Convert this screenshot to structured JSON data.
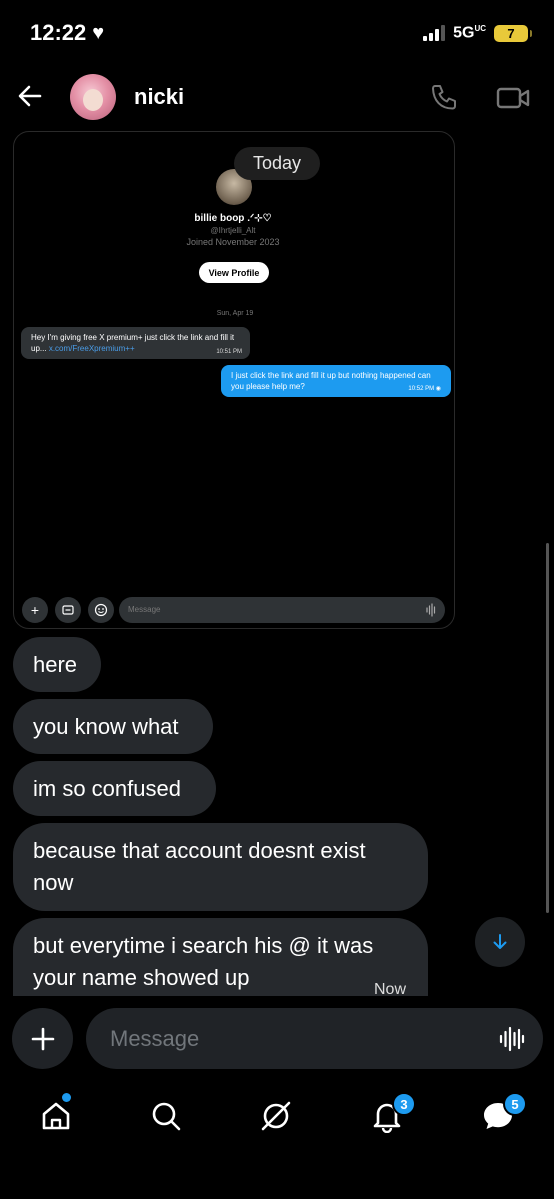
{
  "status_bar": {
    "time": "12:22",
    "network": "5G",
    "network_sup": "UC",
    "battery": "7"
  },
  "header": {
    "contact_name": "nicki"
  },
  "shared_screenshot": {
    "today_label": "Today",
    "profile_name": "billie boop .ᐟ⊹♡",
    "profile_handle": "@Ihrtjelli_Alt",
    "profile_joined": "Joined November 2023",
    "view_profile_label": "View Profile",
    "date_divider": "Sun, Apr 19",
    "incoming_text": "Hey I'm giving free X premium+ just click the link and fill it up...",
    "incoming_link": "x.com/FreeXpremium++",
    "incoming_time": "10:51 PM",
    "outgoing_text": "I just click the link and fill it up but nothing happened can you please help me?",
    "outgoing_time": "10:52 PM",
    "composer_placeholder": "Message"
  },
  "messages": [
    {
      "text": "here"
    },
    {
      "text": "you know what"
    },
    {
      "text": "im so confused"
    },
    {
      "text": "because that account doesnt exist now"
    },
    {
      "text": "but everytime i search his @ it was your name showed up",
      "time": "Now"
    }
  ],
  "composer": {
    "placeholder": "Message"
  },
  "tabs": {
    "notifications_badge": "3",
    "messages_badge": "5"
  },
  "colors": {
    "accent": "#1d9bf0",
    "bubble": "#26292d",
    "background": "#000000"
  }
}
